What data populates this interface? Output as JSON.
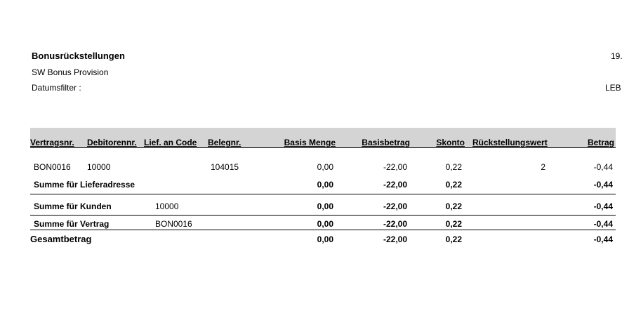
{
  "report": {
    "title": "Bonusrückstellungen",
    "subtitle": "SW Bonus Provision",
    "filter_label": "Datumsfilter :",
    "date_fragment": "19.",
    "user_fragment": "LEB"
  },
  "columns": {
    "vertragsnr": "Vertragsnr.",
    "debitorennr": "Debitorennr.",
    "lief_an_code": "Lief. an Code",
    "belegnr": "Belegnr.",
    "basis_menge": "Basis Menge",
    "basisbetrag": "Basisbetrag",
    "skonto": "Skonto",
    "rueckstellungswert": "Rückstellungswert",
    "betrag": "Betrag"
  },
  "detail_row": {
    "vertragsnr": "BON0016",
    "debitorennr": "10000",
    "belegnr": "104015",
    "basis_menge": "0,00",
    "basisbetrag": "-22,00",
    "skonto": "0,22",
    "rueckstellungswert": "2",
    "betrag": "-0,44"
  },
  "sum_lieferadresse": {
    "label": "Summe für Lieferadresse",
    "basis_menge": "0,00",
    "basisbetrag": "-22,00",
    "skonto": "0,22",
    "betrag": "-0,44"
  },
  "sum_kunden": {
    "label": "Summe für Kunden",
    "code": "10000",
    "basis_menge": "0,00",
    "basisbetrag": "-22,00",
    "skonto": "0,22",
    "betrag": "-0,44"
  },
  "sum_vertrag": {
    "label": "Summe für Vertrag",
    "code": "BON0016",
    "basis_menge": "0,00",
    "basisbetrag": "-22,00",
    "skonto": "0,22",
    "betrag": "-0,44"
  },
  "gesamt": {
    "label": "Gesamtbetrag",
    "basis_menge": "0,00",
    "basisbetrag": "-22,00",
    "skonto": "0,22",
    "betrag": "-0,44"
  }
}
